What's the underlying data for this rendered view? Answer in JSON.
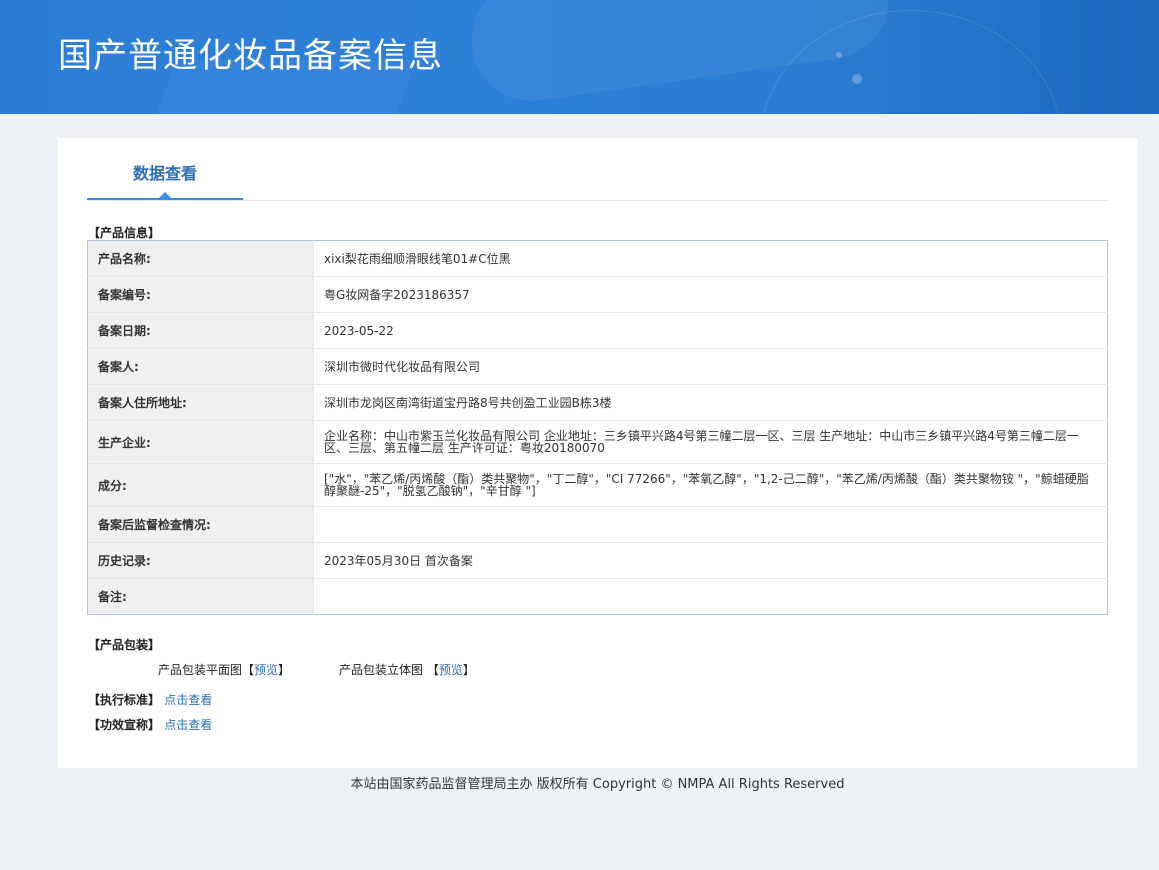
{
  "header": {
    "title": "国产普通化妆品备案信息"
  },
  "tabs": [
    {
      "label": "数据查看"
    }
  ],
  "product_info": {
    "section_title": "【产品信息】",
    "rows": [
      {
        "label": "产品名称:",
        "value": "xixi梨花雨细顺滑眼线笔01#C位黑"
      },
      {
        "label": "备案编号:",
        "value": "粤G妆网备字2023186357"
      },
      {
        "label": "备案日期:",
        "value": "2023-05-22"
      },
      {
        "label": "备案人:",
        "value": "深圳市微时代化妆品有限公司"
      },
      {
        "label": "备案人住所地址:",
        "value": "深圳市龙岗区南湾街道宝丹路8号共创盈工业园B栋3楼"
      },
      {
        "label": "生产企业:",
        "value": "企业名称：中山市紫玉兰化妆品有限公司 企业地址：三乡镇平兴路4号第三幢二层一区、三层 生产地址：中山市三乡镇平兴路4号第三幢二层一区、三层、第五幢二层 生产许可证：粤妆20180070"
      },
      {
        "label": "成分:",
        "value": "[\"水\"，\"苯乙烯/丙烯酸（酯）类共聚物\"，\"丁二醇\"，\"CI 77266\"，\"苯氧乙醇\"，\"1,2-己二醇\"，\"苯乙烯/丙烯酸（酯）类共聚物铵 \"，\"鲸蜡硬脂醇聚醚-25\"，\"脱氢乙酸钠\"，\"辛甘醇 \"]"
      },
      {
        "label": "备案后监督检查情况:",
        "value": ""
      },
      {
        "label": "历史记录:",
        "value": "2023年05月30日 首次备案"
      },
      {
        "label": "备注:",
        "value": ""
      }
    ]
  },
  "packaging": {
    "section_title": "【产品包装】",
    "flat_label": "产品包装平面图",
    "solid_label": "产品包装立体图",
    "bracket_open": "【",
    "bracket_close": "】",
    "preview_label": "预览"
  },
  "standards": {
    "section_title": "【执行标准】",
    "link_label": "点击查看"
  },
  "efficacy": {
    "section_title": "【功效宣称】",
    "link_label": "点击查看"
  },
  "footer": {
    "text": "本站由国家药品监督管理局主办 版权所有 Copyright © NMPA All Rights Reserved"
  }
}
